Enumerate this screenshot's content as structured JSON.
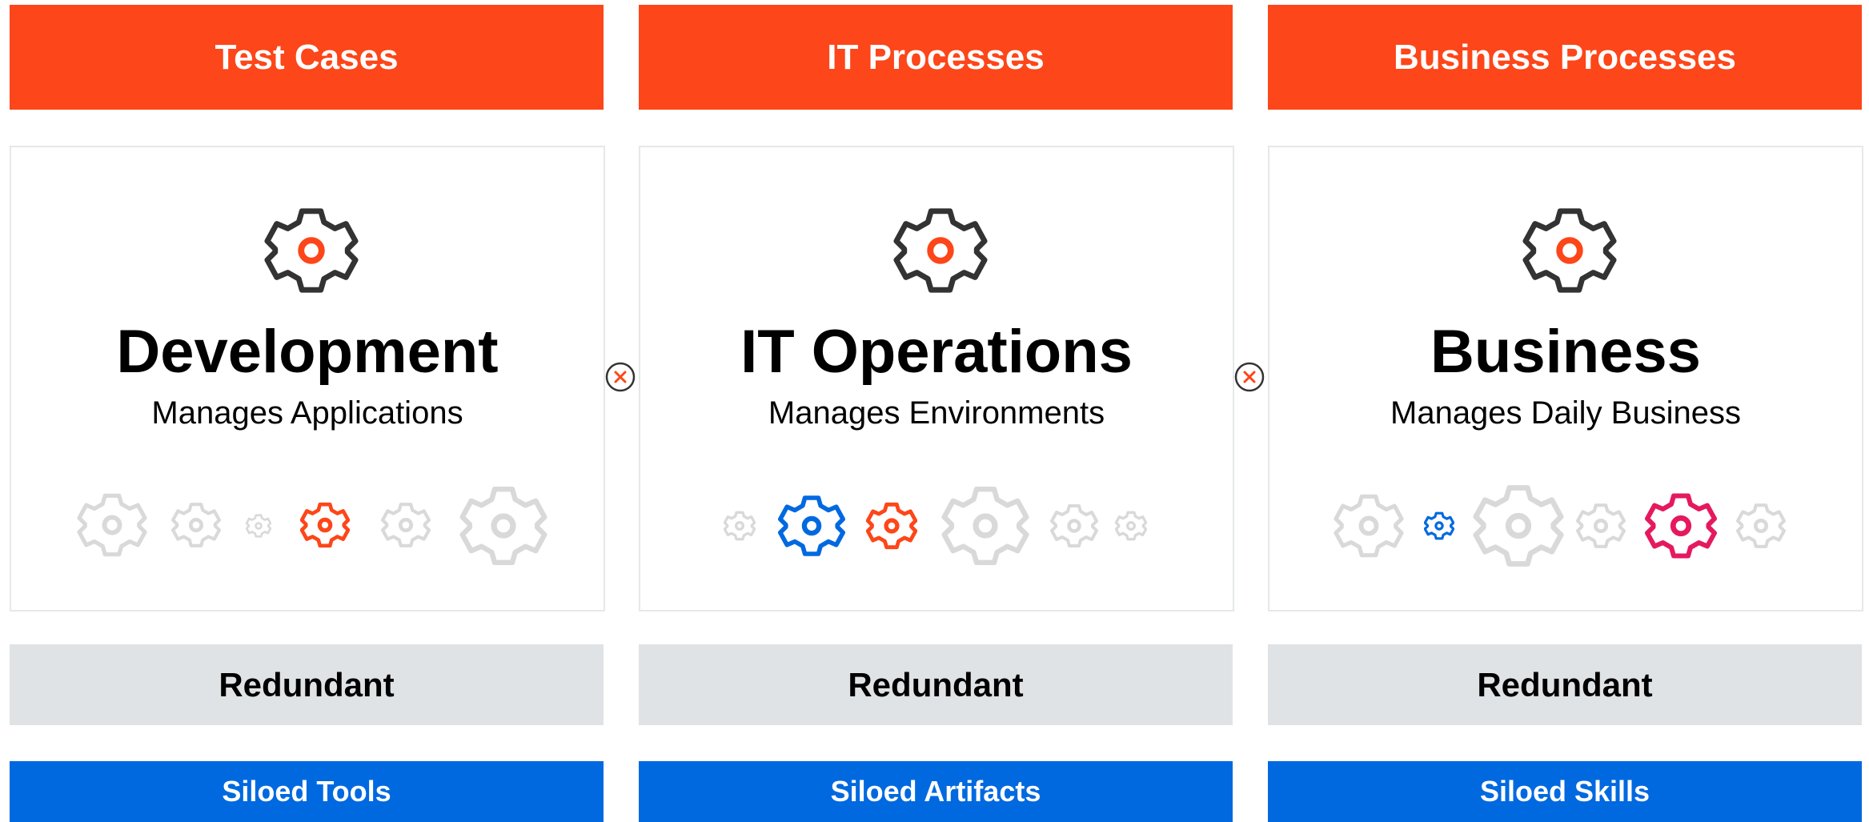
{
  "colors": {
    "header": "#fd4619",
    "siloed": "#0069e0",
    "redundant_bg": "#e0e3e5",
    "gear_dark": "#333333",
    "gear_accent": "#fd4619",
    "gear_faded": "#d9d9d9",
    "gear_blue": "#0069e0",
    "gear_pink": "#e5195f",
    "x_mark": "#fd4619"
  },
  "columns": [
    {
      "header": "Test Cases",
      "title": "Development",
      "subtitle": "Manages Applications",
      "redundant": "Redundant",
      "siloed": "Siloed Tools",
      "gear_row": [
        "gear-faded",
        "gear-faded",
        "gear-faded",
        "gear-orange",
        "gear-faded",
        "gear-faded"
      ]
    },
    {
      "header": "IT Processes",
      "title": "IT Operations",
      "subtitle": "Manages Environments",
      "redundant": "Redundant",
      "siloed": "Siloed Artifacts",
      "gear_row": [
        "gear-faded",
        "gear-blue",
        "gear-orange",
        "gear-faded",
        "gear-faded",
        "gear-faded"
      ]
    },
    {
      "header": "Business Processes",
      "title": "Business",
      "subtitle": "Manages Daily Business",
      "redundant": "Redundant",
      "siloed": "Siloed Skills",
      "gear_row": [
        "gear-faded",
        "gear-blue",
        "gear-faded",
        "gear-faded",
        "gear-pink",
        "gear-faded"
      ]
    }
  ],
  "separators": [
    "x-circle-icon",
    "x-circle-icon"
  ]
}
